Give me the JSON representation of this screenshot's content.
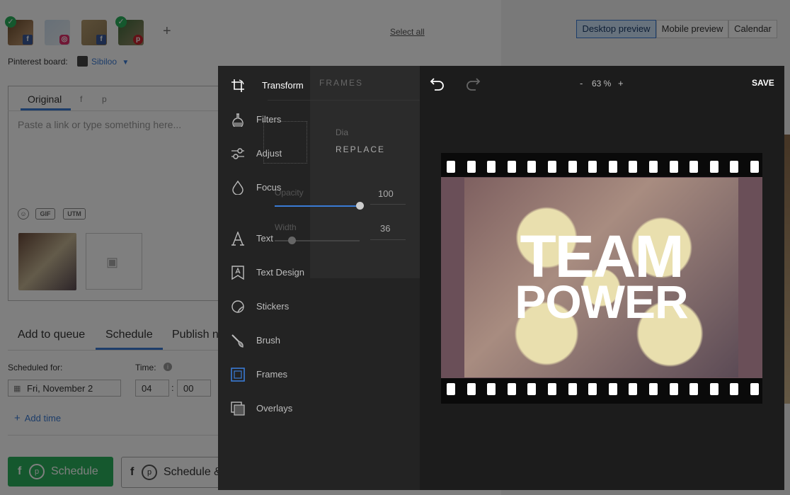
{
  "colors": {
    "accent": "#3a7bd5",
    "green": "#2bb15c",
    "facebook": "#3b5998",
    "pinterest": "#c8232c",
    "instagram": "#e1306c"
  },
  "composer": {
    "add_account_icon": "plus-icon",
    "select_all": "Select all",
    "pinterest_board_label": "Pinterest board:",
    "pinterest_board_value": "Sibiloo",
    "tabs": [
      {
        "label": "Original"
      },
      {
        "label": "f"
      },
      {
        "label": "p"
      }
    ],
    "placeholder": "Paste a link or type something here...",
    "gif_label": "GIF",
    "utm_label": "UTM"
  },
  "preview_tabs": [
    "Desktop preview",
    "Mobile preview",
    "Calendar"
  ],
  "schedule": {
    "tabs": [
      "Add to queue",
      "Schedule",
      "Publish n"
    ],
    "scheduled_for_label": "Scheduled for:",
    "date_value": "Fri, November 2",
    "time_label": "Time:",
    "hour": "04",
    "minute": "00",
    "separator": ":",
    "add_time": "Add time",
    "schedule_button": "Schedule",
    "schedule_and_button": "Schedule &"
  },
  "editor": {
    "tools": [
      {
        "label": "Transform",
        "icon": "crop-icon"
      },
      {
        "label": "Filters",
        "icon": "flask-icon"
      },
      {
        "label": "Adjust",
        "icon": "sliders-icon"
      },
      {
        "label": "Focus",
        "icon": "drop-icon"
      },
      {
        "label": "Text",
        "icon": "text-icon"
      },
      {
        "label": "Text Design",
        "icon": "text-design-icon"
      },
      {
        "label": "Stickers",
        "icon": "sticker-icon"
      },
      {
        "label": "Brush",
        "icon": "brush-icon"
      },
      {
        "label": "Frames",
        "icon": "frame-icon"
      },
      {
        "label": "Overlays",
        "icon": "overlay-icon"
      }
    ],
    "ghost": {
      "frames_header": "FRAMES",
      "dia": "Dia",
      "replace": "REPLACE",
      "opacity_label": "Opacity",
      "opacity_value": "100",
      "width_label": "Width",
      "width_value": "36"
    },
    "zoom_minus": "-",
    "zoom_value": "63 %",
    "zoom_plus": "+",
    "save": "SAVE",
    "image_text_line1": "TEAM",
    "image_text_line2": "POWER"
  }
}
